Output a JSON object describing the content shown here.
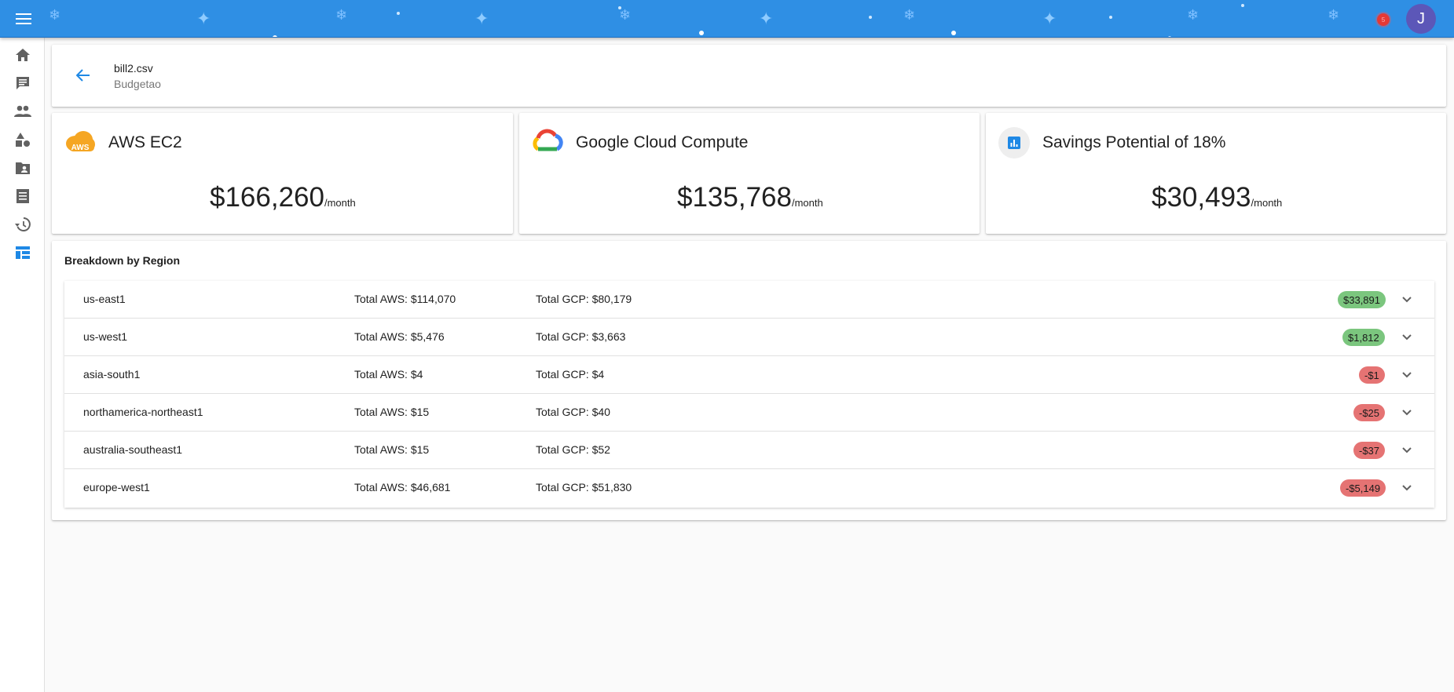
{
  "header": {
    "notification_count": "5",
    "avatar_initial": "J",
    "bar_color": "#2f8fe4"
  },
  "sidebar": {
    "items": [
      {
        "icon": "home-icon"
      },
      {
        "icon": "chat-icon"
      },
      {
        "icon": "people-icon"
      },
      {
        "icon": "category-icon"
      },
      {
        "icon": "folder-account-icon"
      },
      {
        "icon": "receipt-icon"
      },
      {
        "icon": "history-icon"
      },
      {
        "icon": "dashboard-icon",
        "active": true
      }
    ]
  },
  "file": {
    "name": "bill2.csv",
    "subtitle": "Budgetao"
  },
  "metrics": [
    {
      "title": "AWS EC2",
      "amount": "$166,260",
      "unit": "/month",
      "icon": "aws-logo"
    },
    {
      "title": "Google Cloud Compute",
      "amount": "$135,768",
      "unit": "/month",
      "icon": "google-cloud-logo"
    },
    {
      "title": "Savings Potential of 18%",
      "amount": "$30,493",
      "unit": "/month",
      "icon": "bar-chart-icon"
    }
  ],
  "breakdown": {
    "title": "Breakdown by Region",
    "rows": [
      {
        "region": "us-east1",
        "aws": "Total AWS: $114,070",
        "gcp": "Total GCP: $80,179",
        "diff": "$33,891",
        "status": "positive"
      },
      {
        "region": "us-west1",
        "aws": "Total AWS: $5,476",
        "gcp": "Total GCP: $3,663",
        "diff": "$1,812",
        "status": "positive"
      },
      {
        "region": "asia-south1",
        "aws": "Total AWS: $4",
        "gcp": "Total GCP: $4",
        "diff": "-$1",
        "status": "negative"
      },
      {
        "region": "northamerica-northeast1",
        "aws": "Total AWS: $15",
        "gcp": "Total GCP: $40",
        "diff": "-$25",
        "status": "negative"
      },
      {
        "region": "australia-southeast1",
        "aws": "Total AWS: $15",
        "gcp": "Total GCP: $52",
        "diff": "-$37",
        "status": "negative"
      },
      {
        "region": "europe-west1",
        "aws": "Total AWS: $46,681",
        "gcp": "Total GCP: $51,830",
        "diff": "-$5,149",
        "status": "negative"
      }
    ]
  },
  "colors": {
    "positive": "#7bc67e",
    "negative": "#e57373",
    "accent": "#1e88e5"
  }
}
